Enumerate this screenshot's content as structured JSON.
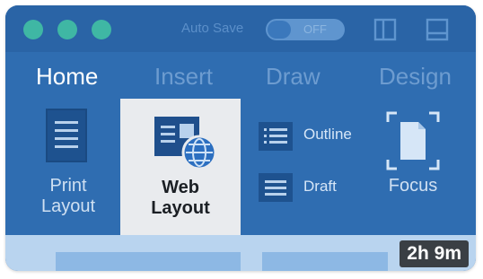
{
  "titlebar": {
    "autosave_label": "Auto Save",
    "toggle_state": "OFF"
  },
  "tabs": [
    {
      "label": "Home",
      "active": true
    },
    {
      "label": "Insert",
      "active": false
    },
    {
      "label": "Draw",
      "active": false
    },
    {
      "label": "Design",
      "active": false
    }
  ],
  "ribbon": {
    "print_layout": {
      "line1": "Print",
      "line2": "Layout"
    },
    "web_layout": {
      "line1": "Web",
      "line2": "Layout"
    },
    "outline": "Outline",
    "draft": "Draft",
    "focus": "Focus"
  },
  "video_duration": "2h 9m",
  "colors": {
    "window_blue": "#2f6db1",
    "traffic_light": "#3fb7a4",
    "selected_bg": "#e9ebee"
  },
  "icons": [
    "print-layout-icon",
    "web-layout-icon",
    "globe-icon",
    "outline-icon",
    "draft-icon",
    "focus-icon",
    "sidebar-icon",
    "window-icon"
  ]
}
